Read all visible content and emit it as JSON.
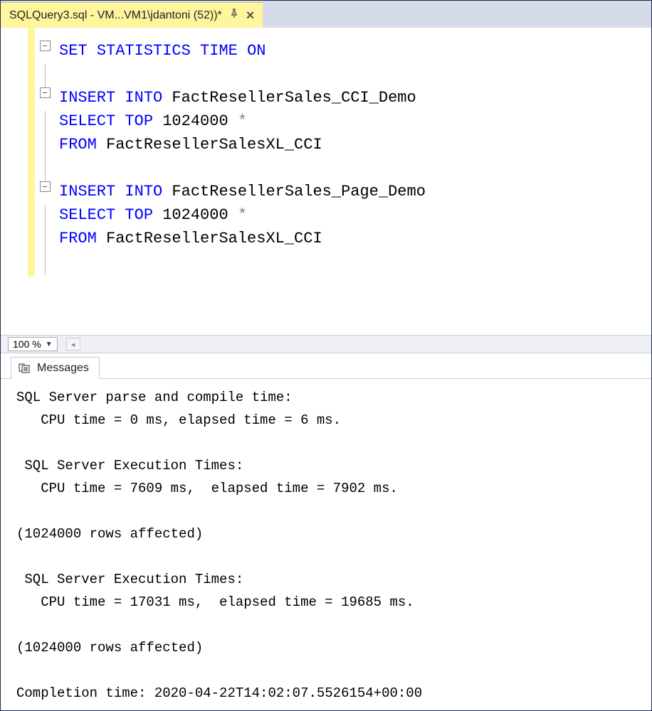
{
  "tab": {
    "title": "SQLQuery3.sql - VM...VM1\\jdantoni (52))*"
  },
  "code": {
    "l1": {
      "a": "SET",
      "b": " ",
      "c": "STATISTICS",
      "d": " ",
      "e": "TIME",
      "f": " ",
      "g": "ON"
    },
    "l3": {
      "a": "INSERT",
      "b": " ",
      "c": "INTO",
      "d": " FactResellerSales_CCI_Demo"
    },
    "l4": {
      "a": "SELECT",
      "b": " ",
      "c": "TOP",
      "d": " 1024000 ",
      "e": "*"
    },
    "l5": {
      "a": "FROM",
      "b": " FactResellerSalesXL_CCI"
    },
    "l7": {
      "a": "INSERT",
      "b": " ",
      "c": "INTO",
      "d": " FactResellerSales_Page_Demo"
    },
    "l8": {
      "a": "SELECT",
      "b": " ",
      "c": "TOP",
      "d": " 1024000 ",
      "e": "*"
    },
    "l9": {
      "a": "FROM",
      "b": " FactResellerSalesXL_CCI"
    }
  },
  "zoom": {
    "value": "100 %"
  },
  "results_tab": {
    "label": "Messages"
  },
  "messages": {
    "m1": "SQL Server parse and compile time: ",
    "m2": "   CPU time = 0 ms, elapsed time = 6 ms.",
    "m3": "",
    "m4": " SQL Server Execution Times:",
    "m5": "   CPU time = 7609 ms,  elapsed time = 7902 ms.",
    "m6": "",
    "m7": "(1024000 rows affected)",
    "m8": "",
    "m9": " SQL Server Execution Times:",
    "m10": "   CPU time = 17031 ms,  elapsed time = 19685 ms.",
    "m11": "",
    "m12": "(1024000 rows affected)",
    "m13": "",
    "m14": "Completion time: 2020-04-22T14:02:07.5526154+00:00"
  }
}
